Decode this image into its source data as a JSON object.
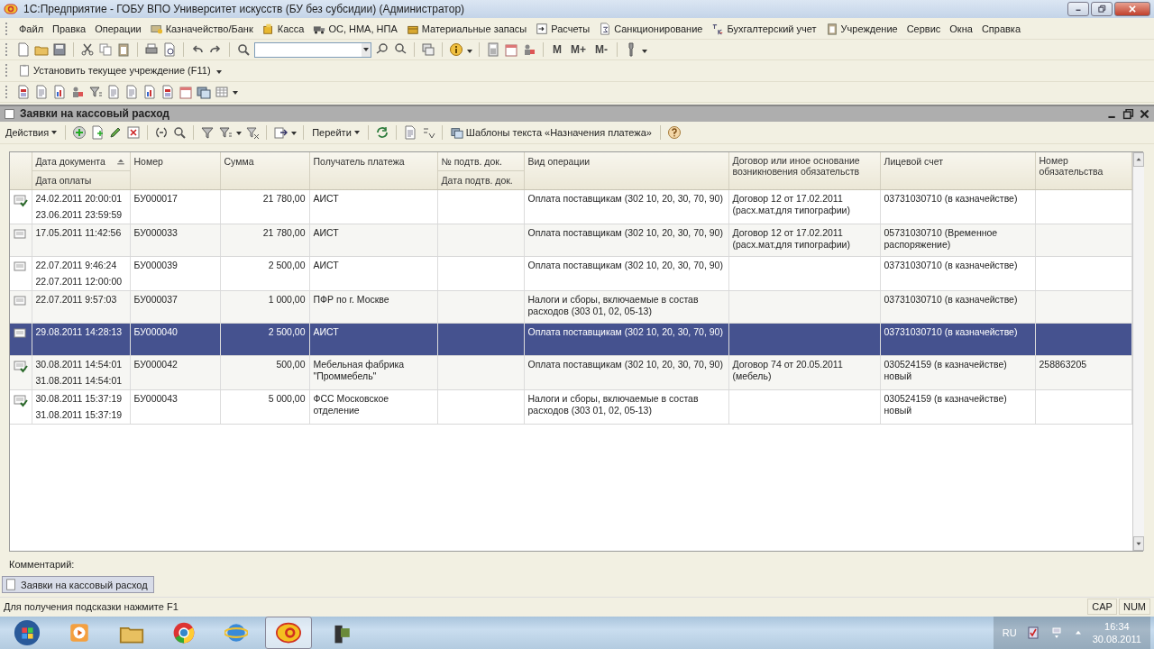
{
  "window": {
    "title": "1С:Предприятие - ГОБУ ВПО Университет искусств (БУ без субсидии) (Администратор)"
  },
  "menu": [
    "Файл",
    "Правка",
    "Операции",
    "Казначейство/Банк",
    "Касса",
    "ОС, НМА, НПА",
    "Материальные запасы",
    "Расчеты",
    "Санкционирование",
    "Бухгалтерский учет",
    "Учреждение",
    "Сервис",
    "Окна",
    "Справка"
  ],
  "memory_buttons": [
    "M",
    "M+",
    "M-"
  ],
  "institution_button": "Установить текущее учреждение (F11)",
  "document_window": {
    "title": "Заявки на кассовый расход",
    "toolbar": {
      "actions": "Действия",
      "goto": "Перейти",
      "templates": "Шаблоны текста «Назначения платежа»"
    },
    "table": {
      "columns": [
        {
          "label": "Дата документа",
          "sublabel": "Дата оплаты",
          "sorted": true
        },
        {
          "label": "Номер",
          "sorted": false
        },
        {
          "label": "Сумма",
          "sorted": false
        },
        {
          "label": "Получатель платежа",
          "sorted": false
        },
        {
          "label": "№ подтв. док.",
          "sublabel": "Дата подтв. док.",
          "sorted": false
        },
        {
          "label": "Вид операции",
          "sorted": false
        },
        {
          "label": "Договор или иное основание возникновения обязательств",
          "sorted": false
        },
        {
          "label": "Лицевой счет",
          "sorted": false
        },
        {
          "label": "Номер обязательства",
          "sorted": false
        }
      ],
      "rows": [
        {
          "posted": true,
          "selected": false,
          "doc_date": "24.02.2011 20:00:01",
          "pay_date": "23.06.2011 23:59:59",
          "number": "БУ000017",
          "sum": "21 780,00",
          "recipient": "АИСТ",
          "operation": "Оплата поставщикам (302 10, 20, 30, 70, 90)",
          "contract": "Договор 12 от 17.02.2011 (расх.мат.для типографии)",
          "account": "03731030710 (в казначействе)"
        },
        {
          "posted": false,
          "selected": false,
          "doc_date": "17.05.2011 11:42:56",
          "number": "БУ000033",
          "sum": "21 780,00",
          "recipient": "АИСТ",
          "operation": "Оплата поставщикам (302 10, 20, 30, 70, 90)",
          "contract": "Договор 12 от 17.02.2011 (расх.мат.для типографии)",
          "account": "05731030710 (Временное распоряжение)"
        },
        {
          "posted": false,
          "selected": false,
          "doc_date": "22.07.2011 9:46:24",
          "pay_date": "22.07.2011 12:00:00",
          "number": "БУ000039",
          "sum": "2 500,00",
          "recipient": "АИСТ",
          "operation": "Оплата поставщикам (302 10, 20, 30, 70, 90)",
          "account": "03731030710 (в казначействе)"
        },
        {
          "posted": false,
          "selected": false,
          "doc_date": "22.07.2011 9:57:03",
          "number": "БУ000037",
          "sum": "1 000,00",
          "recipient": "ПФР по г. Москве",
          "operation": "Налоги и сборы, включаемые в состав расходов (303 01, 02, 05-13)",
          "account": "03731030710 (в казначействе)"
        },
        {
          "posted": false,
          "selected": true,
          "doc_date": "29.08.2011 14:28:13",
          "number": "БУ000040",
          "sum": "2 500,00",
          "recipient": "АИСТ",
          "operation": "Оплата поставщикам (302 10, 20, 30, 70, 90)",
          "account": "03731030710 (в казначействе)"
        },
        {
          "posted": true,
          "selected": false,
          "doc_date": "30.08.2011 14:54:01",
          "pay_date": "31.08.2011 14:54:01",
          "number": "БУ000042",
          "sum": "500,00",
          "recipient": "Мебельная фабрика \"Проммебель\"",
          "operation": "Оплата поставщикам (302 10, 20, 30, 70, 90)",
          "contract": "Договор 74 от 20.05.2011 (мебель)",
          "account": "030524159 (в казначействе) новый",
          "obligation": "258863205"
        },
        {
          "posted": true,
          "selected": false,
          "doc_date": "30.08.2011 15:37:19",
          "pay_date": "31.08.2011 15:37:19",
          "number": "БУ000043",
          "sum": "5 000,00",
          "recipient": "ФСС Московское отделение",
          "operation": "Налоги и сборы, включаемые в состав расходов (303 01, 02, 05-13)",
          "account": "030524159 (в казначействе) новый"
        }
      ]
    },
    "comment_label": "Комментарий:"
  },
  "window_tabs": [
    {
      "label": "Заявки на кассовый расход",
      "selected": true
    }
  ],
  "status_bar": {
    "hint": "Для получения подсказки нажмите F1",
    "indicators": [
      "CAP",
      "NUM"
    ]
  },
  "taskbar": {
    "language": "RU",
    "time": "16:34",
    "date": "30.08.2011"
  }
}
